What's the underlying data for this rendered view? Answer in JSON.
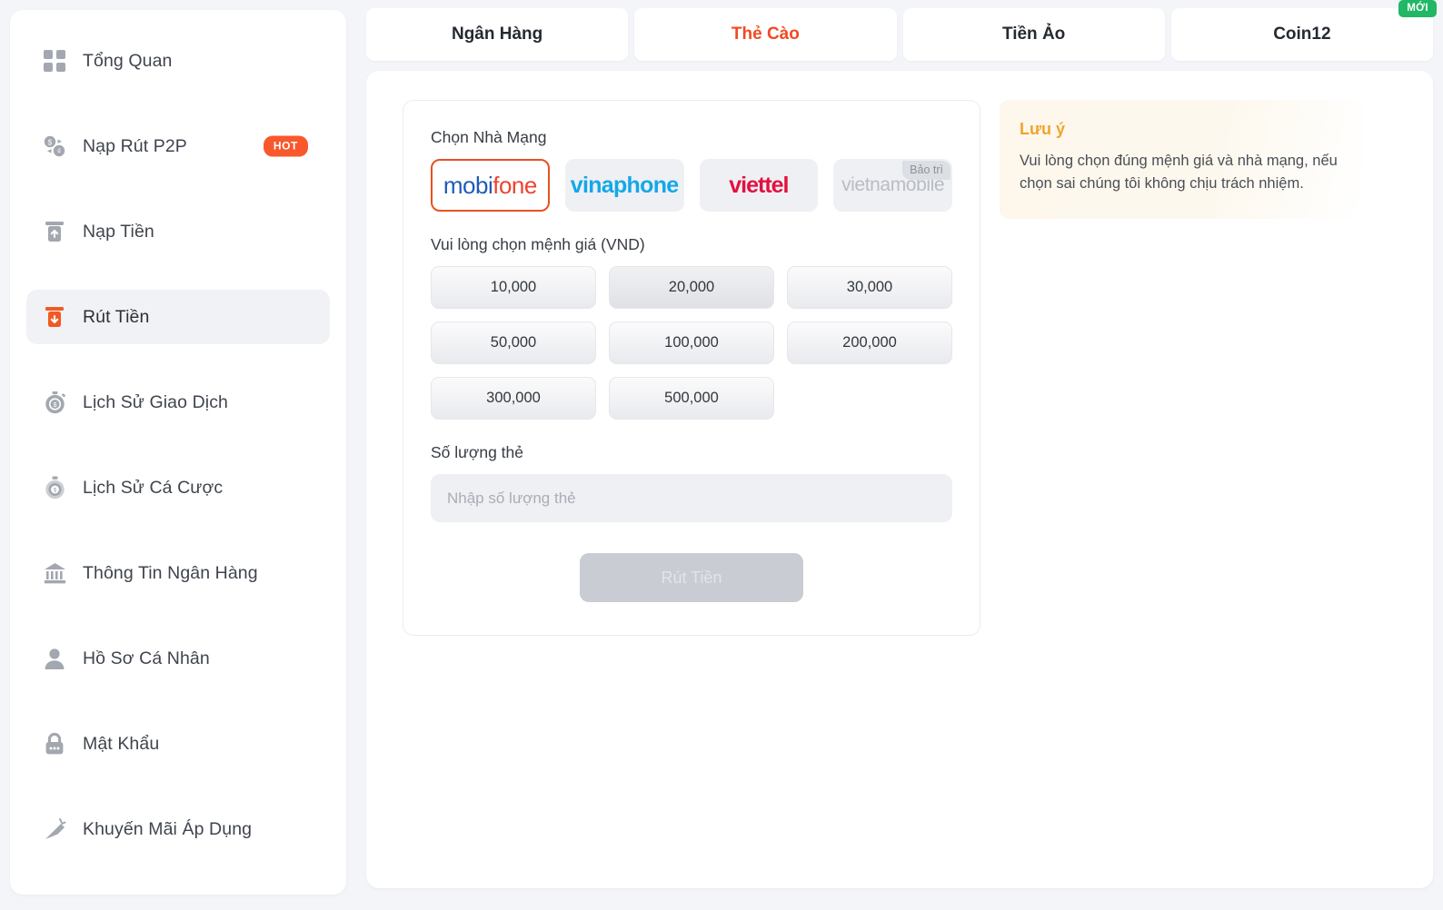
{
  "sidebar": {
    "items": [
      {
        "label": "Tổng Quan",
        "icon": "grid-icon",
        "active": false,
        "badge": null
      },
      {
        "label": "Nạp Rút P2P",
        "icon": "exchange-icon",
        "active": false,
        "badge": "HOT"
      },
      {
        "label": "Nạp Tiền",
        "icon": "deposit-icon",
        "active": false,
        "badge": null
      },
      {
        "label": "Rút Tiền",
        "icon": "withdraw-icon",
        "active": true,
        "badge": null
      },
      {
        "label": "Lịch Sử Giao Dịch",
        "icon": "transaction-history-icon",
        "active": false,
        "badge": null
      },
      {
        "label": "Lịch Sử Cá Cược",
        "icon": "bet-history-icon",
        "active": false,
        "badge": null
      },
      {
        "label": "Thông Tin Ngân Hàng",
        "icon": "bank-icon",
        "active": false,
        "badge": null
      },
      {
        "label": "Hồ Sơ Cá Nhân",
        "icon": "user-icon",
        "active": false,
        "badge": null
      },
      {
        "label": "Mật Khẩu",
        "icon": "lock-icon",
        "active": false,
        "badge": null
      },
      {
        "label": "Khuyến Mãi Áp Dụng",
        "icon": "promotion-icon",
        "active": false,
        "badge": null
      }
    ]
  },
  "tabs": [
    {
      "label": "Ngân Hàng",
      "active": false,
      "badge": null
    },
    {
      "label": "Thẻ Cào",
      "active": true,
      "badge": null
    },
    {
      "label": "Tiền Ảo",
      "active": false,
      "badge": null
    },
    {
      "label": "Coin12",
      "active": false,
      "badge": "MỚI"
    }
  ],
  "form": {
    "carrier_label": "Chọn Nhà Mạng",
    "carriers": [
      {
        "name": "mobifone",
        "part1": "mobi",
        "part2": "fone",
        "selected": true,
        "disabled": false,
        "maintenance": null
      },
      {
        "name": "vinaphone",
        "part1": "vinaphone",
        "part2": "",
        "selected": false,
        "disabled": false,
        "maintenance": null
      },
      {
        "name": "viettel",
        "part1": "viettel",
        "part2": "",
        "selected": false,
        "disabled": false,
        "maintenance": null
      },
      {
        "name": "vietnamobile",
        "part1": "vietnamobile",
        "part2": "",
        "selected": false,
        "disabled": true,
        "maintenance": "Bảo trì"
      }
    ],
    "denom_label": "Vui lòng chọn mệnh giá (VND)",
    "denoms": [
      {
        "value": "10,000",
        "hover": false
      },
      {
        "value": "20,000",
        "hover": true
      },
      {
        "value": "30,000",
        "hover": false
      },
      {
        "value": "50,000",
        "hover": false
      },
      {
        "value": "100,000",
        "hover": false
      },
      {
        "value": "200,000",
        "hover": false
      },
      {
        "value": "300,000",
        "hover": false
      },
      {
        "value": "500,000",
        "hover": false
      }
    ],
    "quantity_label": "Số lượng thẻ",
    "quantity_placeholder": "Nhập số lượng thẻ",
    "quantity_value": "",
    "submit_label": "Rút Tiền"
  },
  "notice": {
    "title": "Lưu ý",
    "body": "Vui lòng chọn đúng mệnh giá và nhà mạng, nếu chọn sai chúng tôi không chịu trách nhiệm."
  },
  "colors": {
    "accent_orange": "#f04a22",
    "badge_hot": "#f8582c",
    "badge_new": "#20b765",
    "notice_title": "#f0a42a",
    "page_bg": "#f4f5f8"
  }
}
